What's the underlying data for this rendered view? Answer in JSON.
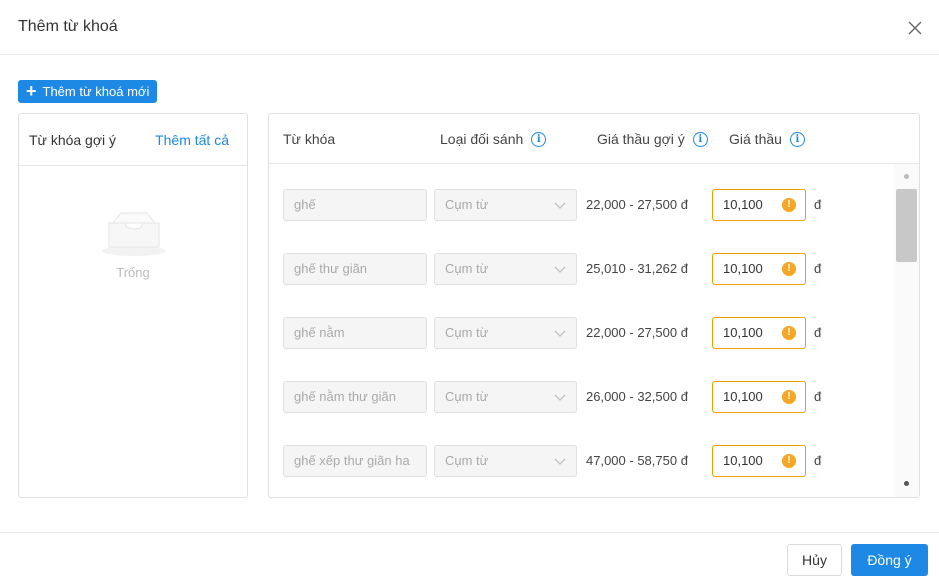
{
  "modal": {
    "title": "Thêm từ khoá",
    "add_new_label": "Thêm từ khoá mới"
  },
  "left_panel": {
    "title": "Từ khóa gợi ý",
    "add_all_label": "Thêm tất cả",
    "empty_text": "Trống"
  },
  "table": {
    "headers": {
      "keyword": "Từ khóa",
      "match_type": "Loại đối sánh",
      "suggested_bid": "Giá thầu gợi ý",
      "bid": "Giá thầu"
    },
    "rows": [
      {
        "keyword": "ghế",
        "match_type": "Cụm từ",
        "suggested_bid": "22,000 - 27,500 đ",
        "bid": "10,100",
        "currency": "đ"
      },
      {
        "keyword": "ghế thư giãn",
        "match_type": "Cụm từ",
        "suggested_bid": "25,010 - 31,262 đ",
        "bid": "10,100",
        "currency": "đ"
      },
      {
        "keyword": "ghế nằm",
        "match_type": "Cụm từ",
        "suggested_bid": "22,000 - 27,500 đ",
        "bid": "10,100",
        "currency": "đ"
      },
      {
        "keyword": "ghế nằm thư giãn",
        "match_type": "Cụm từ",
        "suggested_bid": "26,000 - 32,500 đ",
        "bid": "10,100",
        "currency": "đ"
      },
      {
        "keyword": "ghế xếp thư giãn ha",
        "match_type": "Cụm từ",
        "suggested_bid": "47,000 - 58,750 đ",
        "bid": "10,100",
        "currency": "đ"
      }
    ]
  },
  "footer": {
    "cancel_label": "Hủy",
    "ok_label": "Đồng ý"
  },
  "colors": {
    "primary": "#1e88e5",
    "warning": "#f5a623"
  }
}
